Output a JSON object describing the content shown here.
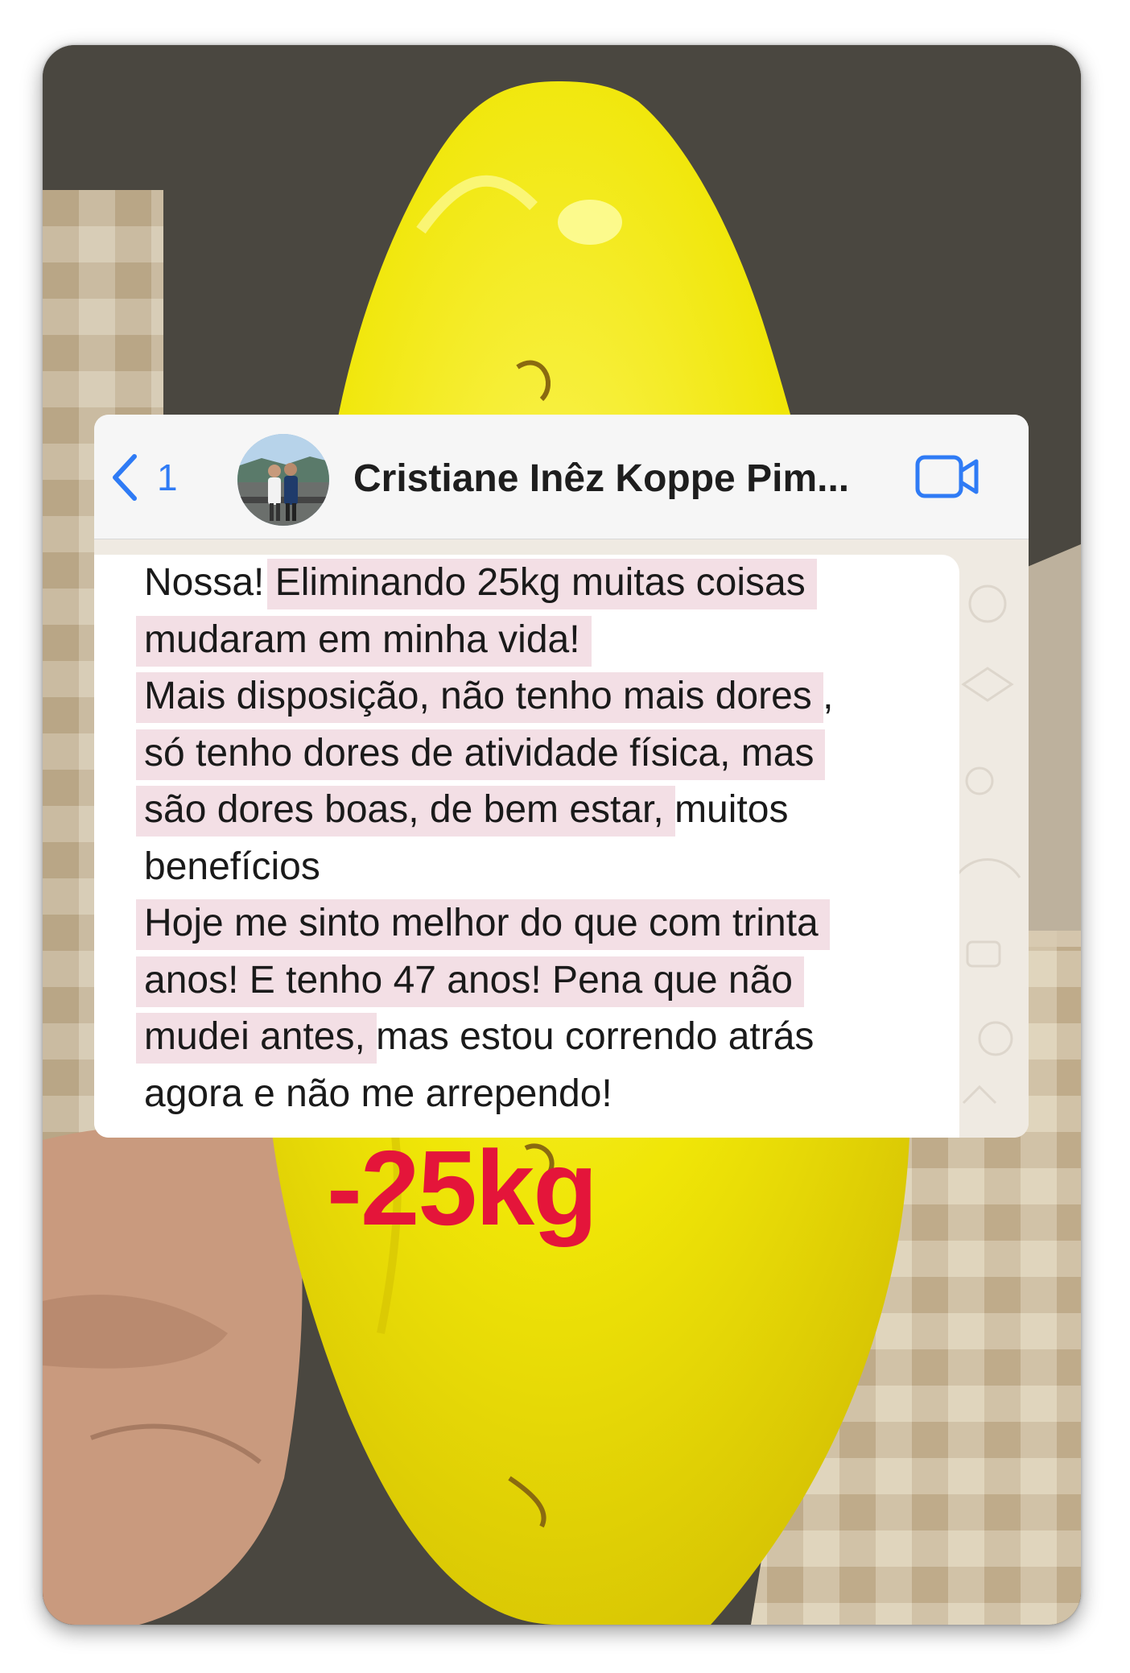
{
  "chat": {
    "back_count": "1",
    "contact_name": "Cristiane Inêz Koppe Pim...",
    "icons": [
      "chevron-left-icon",
      "video-call-icon"
    ],
    "message_lines": [
      {
        "segments": [
          {
            "text": "Nossa! ",
            "highlight": false
          },
          {
            "text": "Eliminando 25kg muitas coisas",
            "highlight": true
          }
        ]
      },
      {
        "segments": [
          {
            "text": "mudaram em minha vida!",
            "highlight": true
          }
        ]
      },
      {
        "segments": [
          {
            "text": "Mais disposição, não tenho mais dores",
            "highlight": true
          },
          {
            "text": " ,",
            "highlight": false
          }
        ]
      },
      {
        "segments": [
          {
            "text": "só tenho dores de atividade física, mas",
            "highlight": true
          }
        ]
      },
      {
        "segments": [
          {
            "text": "são dores boas, de bem estar,",
            "highlight": true
          },
          {
            "text": " muitos",
            "highlight": false
          }
        ]
      },
      {
        "segments": [
          {
            "text": "benefícios",
            "highlight": false
          }
        ]
      },
      {
        "segments": [
          {
            "text": "Hoje me sinto melhor do que com trinta",
            "highlight": true
          }
        ]
      },
      {
        "segments": [
          {
            "text": "anos! E tenho 47 anos! Pena que não",
            "highlight": true
          }
        ]
      },
      {
        "segments": [
          {
            "text": "mudei antes,",
            "highlight": true
          },
          {
            "text": " mas estou correndo atrás",
            "highlight": false
          }
        ]
      },
      {
        "segments": [
          {
            "text": "agora e não me arrependo!",
            "highlight": false
          }
        ]
      }
    ]
  },
  "badge": {
    "text": "-25kg",
    "color": "#e4153a"
  },
  "colors": {
    "fruit": "#f2ea08",
    "highlight": "#f3dfe5",
    "ios_blue": "#2f7bf5"
  }
}
